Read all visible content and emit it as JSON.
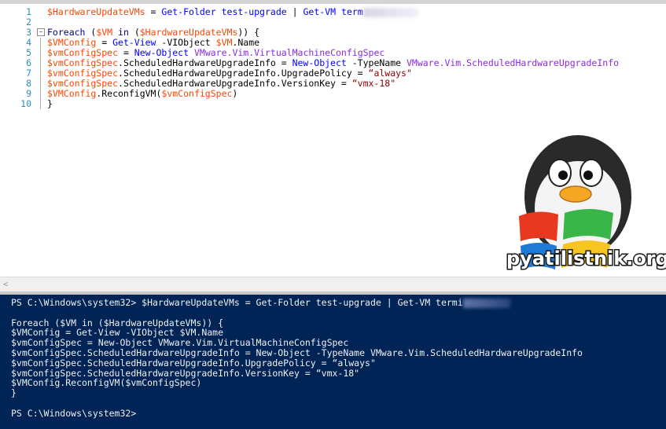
{
  "editor": {
    "lines": [
      {
        "n": "1",
        "segments": [
          [
            "var",
            "$HardwareUpdateVMs"
          ],
          [
            "pl",
            " = "
          ],
          [
            "cmd",
            "Get-Folder"
          ],
          [
            "pl",
            " "
          ],
          [
            "cmd",
            "test-upgrade"
          ],
          [
            "pl",
            " | "
          ],
          [
            "cmd",
            "Get-VM"
          ],
          [
            "pl",
            " "
          ],
          [
            "cmd",
            "term"
          ]
        ],
        "redacted": true
      },
      {
        "n": "2",
        "segments": []
      },
      {
        "n": "3",
        "segments": [
          [
            "kw",
            "Foreach"
          ],
          [
            "pl",
            " ("
          ],
          [
            "var",
            "$VM"
          ],
          [
            "kw",
            " in "
          ],
          [
            "pl",
            "("
          ],
          [
            "var",
            "$HardwareUpdateVMs"
          ],
          [
            "pl",
            ")) {"
          ]
        ]
      },
      {
        "n": "4",
        "segments": [
          [
            "var",
            "$VMConfig"
          ],
          [
            "pl",
            " = "
          ],
          [
            "cmd",
            "Get-View"
          ],
          [
            "pl",
            " -VIObject "
          ],
          [
            "var",
            "$VM"
          ],
          [
            "pl",
            ".Name"
          ]
        ]
      },
      {
        "n": "5",
        "segments": [
          [
            "var",
            "$vmConfigSpec"
          ],
          [
            "pl",
            " = "
          ],
          [
            "cmd",
            "New-Object"
          ],
          [
            "pl",
            " "
          ],
          [
            "typ",
            "VMware.Vim.VirtualMachineConfigSpec"
          ]
        ]
      },
      {
        "n": "6",
        "segments": [
          [
            "var",
            "$vmConfigSpec"
          ],
          [
            "pl",
            ".ScheduledHardwareUpgradeInfo = "
          ],
          [
            "cmd",
            "New-Object"
          ],
          [
            "pl",
            " -TypeName "
          ],
          [
            "typ",
            "VMware.Vim.ScheduledHardwareUpgradeInfo"
          ]
        ]
      },
      {
        "n": "7",
        "segments": [
          [
            "var",
            "$vmConfigSpec"
          ],
          [
            "pl",
            ".ScheduledHardwareUpgradeInfo.UpgradePolicy = "
          ],
          [
            "str",
            "“always\""
          ]
        ]
      },
      {
        "n": "8",
        "segments": [
          [
            "var",
            "$vmConfigSpec"
          ],
          [
            "pl",
            ".ScheduledHardwareUpgradeInfo.VersionKey = "
          ],
          [
            "str",
            "“vmx-18\""
          ]
        ]
      },
      {
        "n": "9",
        "segments": [
          [
            "var",
            "$VMConfig"
          ],
          [
            "pl",
            ".ReconfigVM("
          ],
          [
            "var",
            "$vmConfigSpec"
          ],
          [
            "pl",
            ")"
          ]
        ]
      },
      {
        "n": "10",
        "segments": [
          [
            "pl",
            "}"
          ]
        ]
      }
    ],
    "fold_glyph": "−",
    "scroll_left_glyph": "<"
  },
  "console": {
    "lines": [
      {
        "text": "PS C:\\Windows\\system32> $HardwareUpdateVMs = Get-Folder test-upgrade | Get-VM termi",
        "redacted": true
      },
      {
        "text": ""
      },
      {
        "text": "Foreach ($VM in ($HardwareUpdateVMs)) {"
      },
      {
        "text": "$VMConfig = Get-View -VIObject $VM.Name"
      },
      {
        "text": "$vmConfigSpec = New-Object VMware.Vim.VirtualMachineConfigSpec"
      },
      {
        "text": "$vmConfigSpec.ScheduledHardwareUpgradeInfo = New-Object -TypeName VMware.Vim.ScheduledHardwareUpgradeInfo"
      },
      {
        "text": "$vmConfigSpec.ScheduledHardwareUpgradeInfo.UpgradePolicy = “always\""
      },
      {
        "text": "$vmConfigSpec.ScheduledHardwareUpgradeInfo.VersionKey = “vmx-18\""
      },
      {
        "text": "$VMConfig.ReconfigVM($vmConfigSpec)"
      },
      {
        "text": "}"
      },
      {
        "text": ""
      },
      {
        "text": "PS C:\\Windows\\system32>"
      }
    ]
  },
  "watermark": {
    "text": "pyatilistnik.org",
    "icon": "penguin-windows-logo"
  },
  "colors": {
    "variable": "#ff4500",
    "command": "#0000ff",
    "string": "#8b0000",
    "type": "#8a2be2",
    "keyword": "#00008b",
    "console_bg": "#012456"
  }
}
